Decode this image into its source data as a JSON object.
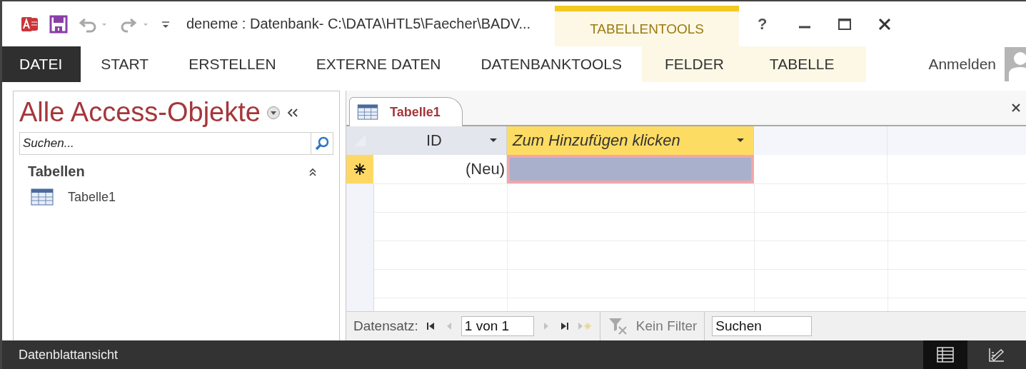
{
  "title_bar": {
    "title": "deneme : Datenbank- C:\\DATA\\HTL5\\Faecher\\BADV...",
    "context_group": "TABELLENTOOLS",
    "help": "?"
  },
  "ribbon_tabs": [
    {
      "label": "DATEI",
      "kind": "file"
    },
    {
      "label": "START",
      "kind": "normal"
    },
    {
      "label": "ERSTELLEN",
      "kind": "normal"
    },
    {
      "label": "EXTERNE DATEN",
      "kind": "normal"
    },
    {
      "label": "DATENBANKTOOLS",
      "kind": "normal"
    },
    {
      "label": "FELDER",
      "kind": "contextual"
    },
    {
      "label": "TABELLE",
      "kind": "contextual"
    }
  ],
  "account": {
    "label": "Anmelden"
  },
  "nav_pane": {
    "title": "Alle Access-Objekte",
    "search": {
      "placeholder": "Suchen..."
    },
    "groups": [
      {
        "label": "Tabellen",
        "expanded": true,
        "items": [
          {
            "label": "Tabelle1"
          }
        ]
      }
    ]
  },
  "document_tabs": [
    {
      "label": "Tabelle1",
      "selected": true
    }
  ],
  "datasheet": {
    "columns": [
      {
        "label": "ID",
        "selected": false
      },
      {
        "label": "Zum Hinzufügen klicken",
        "selected": true
      }
    ],
    "new_row": {
      "id": "(Neu)"
    }
  },
  "record_nav": {
    "label": "Datensatz:",
    "position": "1 von 1",
    "filter": "Kein Filter",
    "search": {
      "placeholder": "Suchen"
    }
  },
  "status_bar": {
    "text": "Datenblattansicht",
    "views": [
      {
        "kind": "datasheet",
        "selected": true
      },
      {
        "kind": "design",
        "selected": false
      }
    ]
  }
}
